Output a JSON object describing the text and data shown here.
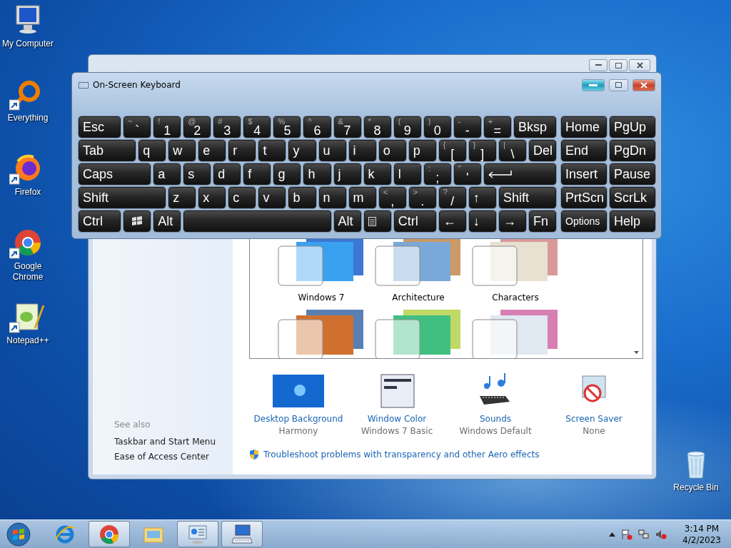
{
  "desktop_icons": [
    {
      "label": "My Computer",
      "kind": "computer",
      "shortcut": false
    },
    {
      "label": "Everything",
      "kind": "everything",
      "shortcut": true
    },
    {
      "label": "Firefox",
      "kind": "firefox",
      "shortcut": true
    },
    {
      "label": "Google Chrome",
      "kind": "chrome",
      "shortcut": true
    },
    {
      "label": "Notepad++",
      "kind": "notepad",
      "shortcut": true
    }
  ],
  "recycle_bin": {
    "label": "Recycle Bin"
  },
  "personalization_window": {
    "see_also": {
      "heading": "See also",
      "links": [
        "Taskbar and Start Menu",
        "Ease of Access Center"
      ]
    },
    "themes": [
      {
        "name": "Windows 7",
        "kind": "windows"
      },
      {
        "name": "Architecture",
        "kind": "architecture"
      },
      {
        "name": "Characters",
        "kind": "characters"
      },
      {
        "kind": "landscapes"
      },
      {
        "kind": "nature"
      },
      {
        "kind": "scenes"
      }
    ],
    "settings": [
      {
        "label": "Desktop Background",
        "value": "Harmony",
        "kind": "background"
      },
      {
        "label": "Window Color",
        "value": "Windows 7 Basic",
        "kind": "color"
      },
      {
        "label": "Sounds",
        "value": "Windows Default",
        "kind": "sounds"
      },
      {
        "label": "Screen Saver",
        "value": "None",
        "kind": "screensaver"
      }
    ],
    "troubleshoot_link": "Troubleshoot problems with transparency and other Aero effects"
  },
  "keyboard_window": {
    "title": "On-Screen Keyboard",
    "rows": [
      {
        "keys": [
          {
            "kind": "text",
            "label": "Esc"
          },
          {
            "kind": "dual",
            "shift": "~",
            "label": "`"
          },
          {
            "kind": "dual",
            "shift": "!",
            "label": "1"
          },
          {
            "kind": "dual",
            "shift": "@",
            "label": "2"
          },
          {
            "kind": "dual",
            "shift": "#",
            "label": "3"
          },
          {
            "kind": "dual",
            "shift": "$",
            "label": "4"
          },
          {
            "kind": "dual",
            "shift": "%",
            "label": "5"
          },
          {
            "kind": "dual",
            "shift": "^",
            "label": "6"
          },
          {
            "kind": "dual",
            "shift": "&",
            "label": "7"
          },
          {
            "kind": "dual",
            "shift": "*",
            "label": "8"
          },
          {
            "kind": "dual",
            "shift": "(",
            "label": "9"
          },
          {
            "kind": "dual",
            "shift": ")",
            "label": "0"
          },
          {
            "kind": "dual",
            "shift": "-",
            "label": "-"
          },
          {
            "kind": "dual",
            "shift": "+",
            "label": "="
          },
          {
            "kind": "text",
            "label": "Bksp"
          }
        ]
      },
      {
        "keys": [
          {
            "kind": "text",
            "label": "Tab"
          },
          {
            "kind": "text",
            "label": "q"
          },
          {
            "kind": "text",
            "label": "w"
          },
          {
            "kind": "text",
            "label": "e"
          },
          {
            "kind": "text",
            "label": "r"
          },
          {
            "kind": "text",
            "label": "t"
          },
          {
            "kind": "text",
            "label": "y"
          },
          {
            "kind": "text",
            "label": "u"
          },
          {
            "kind": "text",
            "label": "i"
          },
          {
            "kind": "text",
            "label": "o"
          },
          {
            "kind": "text",
            "label": "p"
          },
          {
            "kind": "dual",
            "shift": "{",
            "label": "["
          },
          {
            "kind": "dual",
            "shift": "}",
            "label": "]"
          },
          {
            "kind": "dual",
            "shift": "|",
            "label": "\\"
          },
          {
            "kind": "text",
            "label": "Del"
          }
        ]
      },
      {
        "keys": [
          {
            "kind": "text",
            "label": "Caps"
          },
          {
            "kind": "text",
            "label": "a"
          },
          {
            "kind": "text",
            "label": "s"
          },
          {
            "kind": "text",
            "label": "d"
          },
          {
            "kind": "text",
            "label": "f"
          },
          {
            "kind": "text",
            "label": "g"
          },
          {
            "kind": "text",
            "label": "h"
          },
          {
            "kind": "text",
            "label": "j"
          },
          {
            "kind": "text",
            "label": "k"
          },
          {
            "kind": "text",
            "label": "l"
          },
          {
            "kind": "dual",
            "shift": ":",
            "label": ";"
          },
          {
            "kind": "dual",
            "shift": "\"",
            "label": "'"
          },
          {
            "kind": "enter"
          }
        ]
      },
      {
        "keys": [
          {
            "kind": "text",
            "label": "Shift"
          },
          {
            "kind": "text",
            "label": "z"
          },
          {
            "kind": "text",
            "label": "x"
          },
          {
            "kind": "text",
            "label": "c"
          },
          {
            "kind": "text",
            "label": "v"
          },
          {
            "kind": "text",
            "label": "b"
          },
          {
            "kind": "text",
            "label": "n"
          },
          {
            "kind": "text",
            "label": "m"
          },
          {
            "kind": "dual",
            "shift": "<",
            "label": ","
          },
          {
            "kind": "dual",
            "shift": ">",
            "label": "."
          },
          {
            "kind": "dual",
            "shift": "?",
            "label": "/"
          },
          {
            "kind": "text",
            "label": "↑"
          },
          {
            "kind": "text",
            "label": "Shift"
          }
        ]
      },
      {
        "keys": [
          {
            "kind": "text",
            "label": "Ctrl"
          },
          {
            "kind": "windows"
          },
          {
            "kind": "text",
            "label": "Alt"
          },
          {
            "kind": "space"
          },
          {
            "kind": "text",
            "label": "Alt"
          },
          {
            "kind": "menu"
          },
          {
            "kind": "text",
            "label": "Ctrl"
          },
          {
            "kind": "text",
            "label": "←"
          },
          {
            "kind": "text",
            "label": "↓"
          },
          {
            "kind": "text",
            "label": "→"
          },
          {
            "kind": "text",
            "label": "Fn"
          }
        ]
      }
    ],
    "nav_rows": [
      {
        "keys": [
          {
            "kind": "text",
            "label": "Home"
          },
          {
            "kind": "text",
            "label": "PgUp"
          }
        ]
      },
      {
        "keys": [
          {
            "kind": "text",
            "label": "End"
          },
          {
            "kind": "text",
            "label": "PgDn"
          }
        ]
      },
      {
        "keys": [
          {
            "kind": "text",
            "label": "Insert"
          },
          {
            "kind": "text",
            "label": "Pause"
          }
        ]
      },
      {
        "keys": [
          {
            "kind": "text",
            "label": "PrtScn"
          },
          {
            "kind": "text",
            "label": "ScrLk"
          }
        ]
      },
      {
        "keys": [
          {
            "kind": "small",
            "label": "Options"
          },
          {
            "kind": "text",
            "label": "Help"
          }
        ]
      }
    ]
  },
  "taskbar": {
    "items": [
      {
        "kind": "ie",
        "running": false
      },
      {
        "kind": "chrome",
        "running": true
      },
      {
        "kind": "explorer",
        "running": false
      },
      {
        "kind": "control-panel",
        "running": true
      },
      {
        "kind": "keyboard",
        "running": true
      }
    ],
    "time": "3:14 PM",
    "date": "4/2/2023"
  }
}
